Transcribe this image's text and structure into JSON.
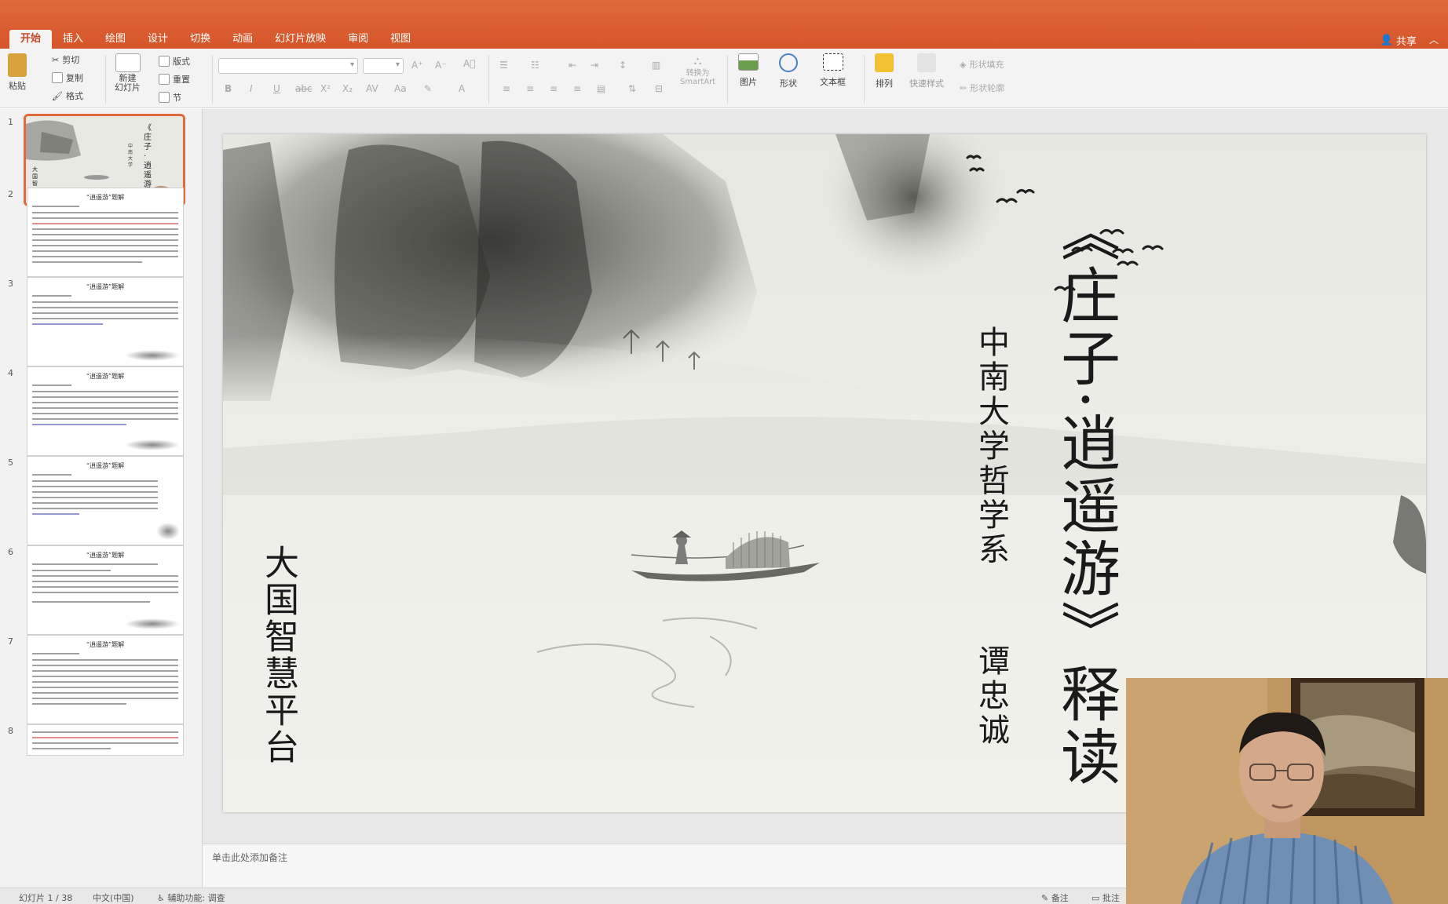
{
  "ribbon_tabs": [
    {
      "label": "开始",
      "active": true
    },
    {
      "label": "插入"
    },
    {
      "label": "绘图"
    },
    {
      "label": "设计"
    },
    {
      "label": "切换"
    },
    {
      "label": "动画"
    },
    {
      "label": "幻灯片放映"
    },
    {
      "label": "审阅"
    },
    {
      "label": "视图"
    }
  ],
  "share_label": "共享",
  "ribbon": {
    "paste": "粘贴",
    "cut": "剪切",
    "copy": "复制",
    "format_painter": "格式",
    "new_slide": "新建\n幻灯片",
    "layout": "版式",
    "reset": "重置",
    "section": "节",
    "convert_smartart": "转换为\nSmartArt",
    "picture": "图片",
    "shape": "形状",
    "textbox": "文本框",
    "arrange": "排列",
    "quick_styles": "快速样式",
    "shape_fill": "形状填充",
    "shape_outline": "形状轮廓"
  },
  "thumbnails": [
    {
      "number": "1",
      "title": "",
      "selected": true
    },
    {
      "number": "2",
      "title": "“逍遥游”题解"
    },
    {
      "number": "3",
      "title": "“逍遥游”题解"
    },
    {
      "number": "4",
      "title": "“逍遥游”题解"
    },
    {
      "number": "5",
      "title": "“逍遥游”题解"
    },
    {
      "number": "6",
      "title": "“逍遥游”题解"
    },
    {
      "number": "7",
      "title": "“逍遥游”题解"
    },
    {
      "number": "8",
      "title": ""
    }
  ],
  "slide": {
    "main_title": "《庄子·逍遥游》释读",
    "university": "中南大学哲学系",
    "author": "谭忠诚",
    "platform": "大国智慧平台"
  },
  "notes_placeholder": "单击此处添加备注",
  "status": {
    "slide_counter": "幻灯片 1 / 38",
    "language": "中文(中国)",
    "accessibility": "辅助功能: 调查",
    "notes_btn": "备注",
    "comments_btn": "批注"
  }
}
